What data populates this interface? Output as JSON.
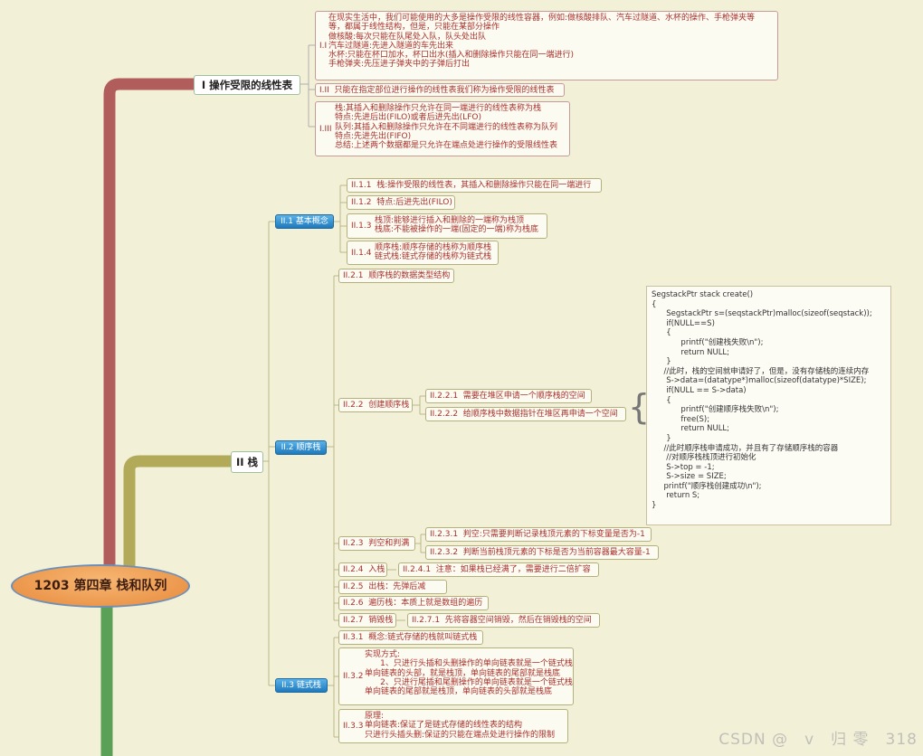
{
  "root": {
    "label": "1203 第四章  栈和队列"
  },
  "s1": {
    "label": "I 操作受限的线性表",
    "i1": {
      "tag": "I.I",
      "body": "在现实生活中，我们可能使用的大多是操作受限的线性容器，例如:做核酸排队、汽车过隧道、水杯的操作、手枪弹夹等\n等，都属于线性结构，但是，只能在某部分操作\n做核酸:每次只能在队尾处入队，队头处出队\n汽车过隧道:先进入隧道的车先出来\n水杯:只能在杯口加水，杯口出水(插入和删除操作只能在同一端进行)\n手枪弹夹:先压进子弹夹中的子弹后打出"
    },
    "i2": {
      "text": "I.II  只能在指定部位进行操作的线性表我们称为操作受限的线性表"
    },
    "i3": {
      "tag": "I.III",
      "body": "栈:其插入和删除操作只允许在同一端进行的线性表称为栈\n特点:先进后出(FILO)或者后进先出(LFO)\n队列:其插入和删除操作只允许在不同端进行的线性表称为队列\n特点:先进先出(FIFO)\n总结:上述两个数据都是只允许在端点处进行操作的受限线性表"
    }
  },
  "s2": {
    "label": "II 栈",
    "c1": {
      "label": "II.1  基本概念",
      "a": "II.1.1  栈:操作受限的线性表，其插入和删除操作只能在同一端进行",
      "b": "II.1.2  特点:后进先出(FILO)",
      "c": {
        "tag": "II.1.3",
        "body": "栈顶:能够进行插入和删除的一端称为栈顶\n栈底:不能被操作的一端(固定的一端)称为栈底"
      },
      "d": {
        "tag": "II.1.4",
        "body": "顺序栈:顺序存储的栈称为顺序栈\n链式栈:链式存储的栈称为链式栈"
      }
    },
    "c2": {
      "label": "II.2  顺序栈",
      "a": "II.2.1  顺序栈的数据类型结构",
      "b": {
        "label": "II.2.2  创建顺序栈",
        "x": "II.2.2.1  需要在堆区申请一个顺序栈的空间",
        "y": "II.2.2.2  给顺序栈中数据指针在堆区再申请一个空间",
        "code": "SegstackPtr stack create()\n{\n      SegstackPtr s=(seqstackPtr)malloc(sizeof(seqstack));\n      if(NULL==S)\n      {\n            printf(\"创建栈失败\\n\");\n            return NULL;\n      }\n     //此时，栈的空间就申请好了，但是，没有存储栈的连续内存\n      S->data=(datatype*)malloc(sizeof(datatype)*SIZE);\n      if(NULL == S->data)\n      {\n            printf(\"创建顺序栈失败\\n\");\n            free(S);\n            return NULL;\n      }\n     //此时顺序栈申请成功，并且有了存储顺序栈的容器\n      //对顺序栈栈顶进行初始化\n      S->top = -1;\n      S->size = SIZE;\n     printf(\"顺序栈创建成功\\n\");\n      return S;\n}"
      },
      "c": {
        "label": "II.2.3  判空和判满",
        "x": "II.2.3.1  判空:只需要判断记录栈顶元素的下标变量是否为-1",
        "y": "II.2.3.2  判断当前栈顶元素的下标是否为当前容器最大容量-1"
      },
      "d": {
        "label": "II.2.4  入栈",
        "x": "II.2.4.1  注意：如果栈已经满了，需要进行二倍扩容"
      },
      "e": "II.2.5  出栈：先弹后减",
      "f": "II.2.6  遍历栈：本质上就是数组的遍历",
      "g": {
        "label": "II.2.7  销毁栈",
        "x": "II.2.7.1  先将容器空间销毁，然后在销毁栈的空间"
      }
    },
    "c3": {
      "label": "II.3  链式栈",
      "a": "II.3.1  概念:链式存储的栈就叫链式栈",
      "b": {
        "tag": "II.3.2",
        "body": "实现方式:\n      1、只进行头插和头删操作的单向链表就是一个链式栈\n单向链表的头部，就是栈顶，单向链表的尾部就是栈底\n      2、只进行尾插和尾删操作的单向链表就是一个链式栈\n单向链表的尾部就是栈顶，单向链表的头部就是栈底"
      },
      "c": {
        "tag": "II.3.3",
        "body": "原理:\n单向链表:保证了是链式存储的线性表的结构\n只进行头插头删:保证的只能在端点处进行操作的限制"
      }
    }
  },
  "watermark": "CSDN @　v　归 零　318",
  "colors": {
    "branch1": "#b15d5c",
    "branch2": "#b2aa59",
    "branch3": "#5aa157",
    "root": "#e78a3c"
  }
}
